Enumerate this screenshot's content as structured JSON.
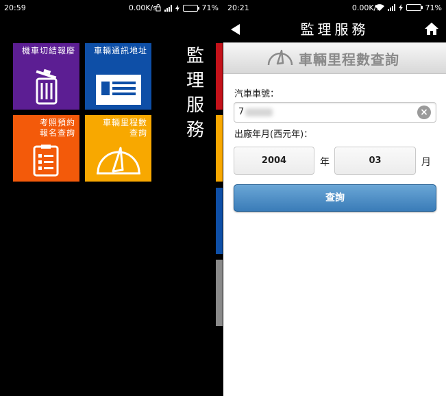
{
  "left_screen": {
    "status": {
      "time": "20:59",
      "speed": "0.00K/s",
      "battery": "71%",
      "battery_level": 0.71
    },
    "tiles": [
      {
        "label": "機車切結報廢",
        "icon": "trash-icon",
        "color": "#5c1e93"
      },
      {
        "label": "車輛通訊地址",
        "icon": "address-card-icon",
        "color": "#0e4fa7"
      },
      {
        "label": "考照預約\n報名查詢",
        "icon": "clipboard-icon",
        "color": "#f35a0a"
      },
      {
        "label": "車輛里程數\n查詢",
        "icon": "gauge-icon",
        "color": "#f8a800"
      }
    ],
    "title": "監理服務",
    "strip_colors": [
      "#c4121a",
      "#f8a800",
      "#0e4fa7",
      "#8a8a8a"
    ]
  },
  "right_screen": {
    "status": {
      "time": "20:21",
      "speed": "0.00K/s",
      "battery": "71%",
      "battery_level": 0.71
    },
    "appbar": {
      "title": "監理服務",
      "back_icon": "back-arrow-icon",
      "home_icon": "home-icon"
    },
    "subheader": {
      "title": "車輛里程數查詢",
      "icon": "gauge-icon"
    },
    "form": {
      "plate_label": "汽車車號：",
      "plate_value": "7",
      "date_label": "出廠年月(西元年)：",
      "year": "2004",
      "year_unit": "年",
      "month": "03",
      "month_unit": "月",
      "submit": "查詢"
    }
  }
}
